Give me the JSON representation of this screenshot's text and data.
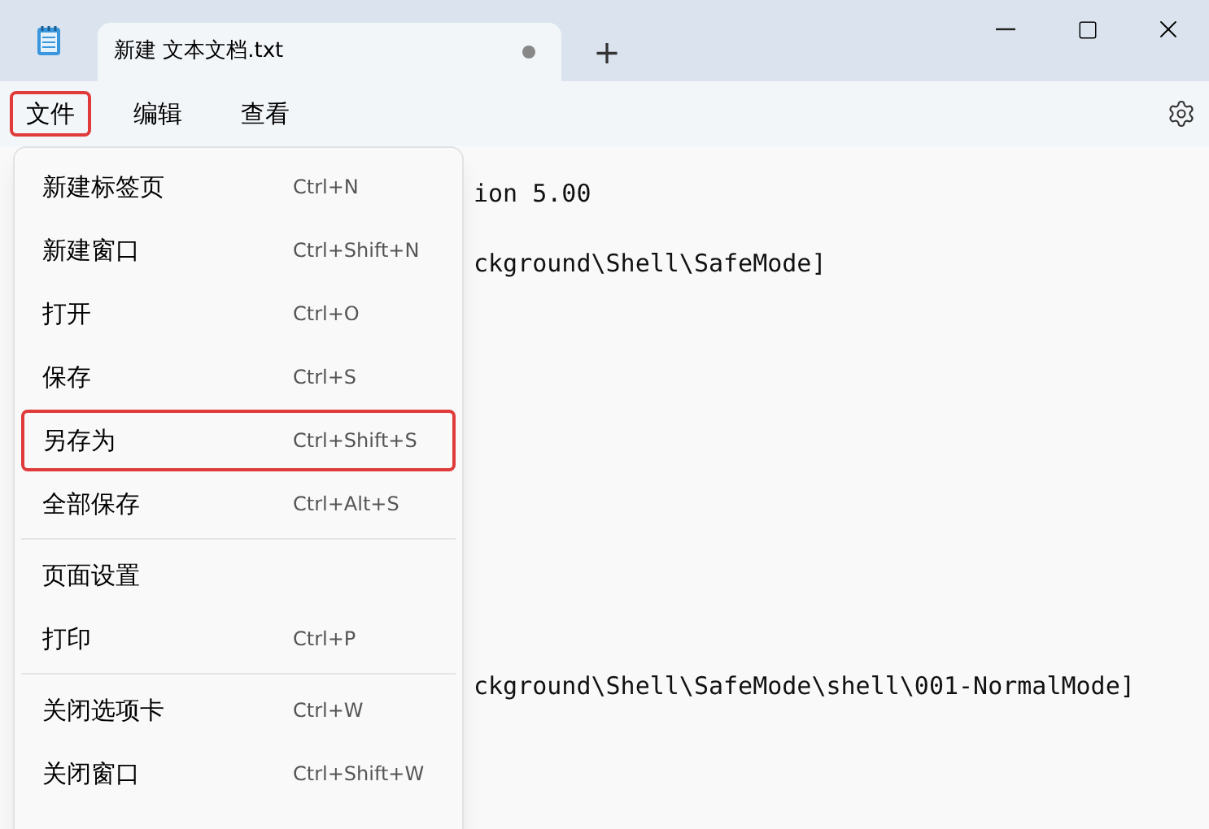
{
  "tab": {
    "title": "新建 文本文档.txt",
    "unsaved": true
  },
  "new_tab": "+",
  "menu_bar": [
    {
      "label": "文件",
      "highlighted": true
    },
    {
      "label": "编辑",
      "highlighted": false
    },
    {
      "label": "查看",
      "highlighted": false
    }
  ],
  "editor": {
    "lines": [
      "ion 5.00",
      "ckground\\Shell\\SafeMode]",
      "ckground\\Shell\\SafeMode\\shell\\001-NormalMode]"
    ]
  },
  "file_menu": {
    "groups": [
      [
        {
          "label": "新建标签页",
          "shortcut": "Ctrl+N",
          "highlighted": false
        },
        {
          "label": "新建窗口",
          "shortcut": "Ctrl+Shift+N",
          "highlighted": false
        },
        {
          "label": "打开",
          "shortcut": "Ctrl+O",
          "highlighted": false
        },
        {
          "label": "保存",
          "shortcut": "Ctrl+S",
          "highlighted": false
        },
        {
          "label": "另存为",
          "shortcut": "Ctrl+Shift+S",
          "highlighted": true
        },
        {
          "label": "全部保存",
          "shortcut": "Ctrl+Alt+S",
          "highlighted": false
        }
      ],
      [
        {
          "label": "页面设置",
          "highlighted": false
        },
        {
          "label": "打印",
          "shortcut": "Ctrl+P",
          "highlighted": false
        }
      ],
      [
        {
          "label": "关闭选项卡",
          "shortcut": "Ctrl+W",
          "highlighted": false
        },
        {
          "label": "关闭窗口",
          "shortcut": "Ctrl+Shift+W",
          "highlighted": false
        }
      ]
    ]
  }
}
